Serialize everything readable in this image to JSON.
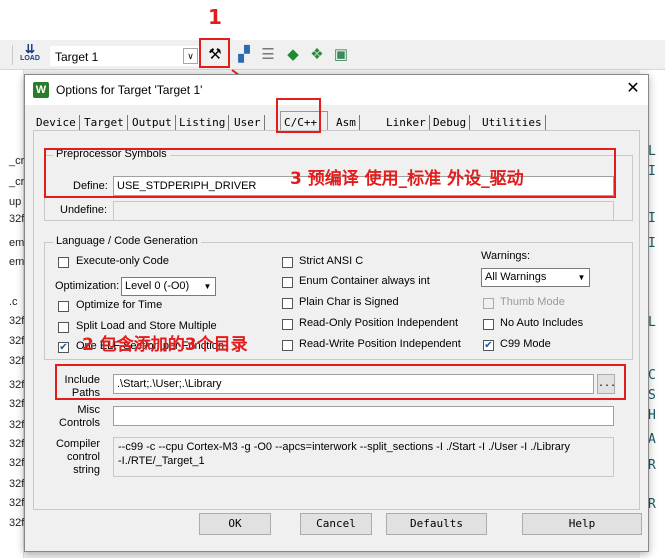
{
  "ide": {
    "target_name": "Target 1",
    "load_label": "LOAD",
    "left_fragments": [
      "_cr",
      "_cr",
      "up",
      "32f",
      "em",
      "em",
      ".c",
      "32f",
      "32f",
      "32f",
      "32f",
      "32f",
      "32f",
      "32f",
      "32f",
      "32f",
      "32f",
      "32f"
    ],
    "right_fragments": [
      "L",
      "I",
      "I",
      "I",
      "L",
      "C",
      "S",
      "H",
      "A",
      "R",
      "R"
    ]
  },
  "dialog": {
    "title": "Options for Target 'Target 1'",
    "close_glyph": "✕",
    "app_icon_letter": "W",
    "tabs": [
      "Device",
      "Target",
      "Output",
      "Listing",
      "User",
      "C/C++",
      "Asm",
      "Linker",
      "Debug",
      "Utilities"
    ],
    "active_tab": "C/C++",
    "preprocessor": {
      "group_title": "Preprocessor Symbols",
      "define_label": "Define:",
      "define_value": "USE_STDPERIPH_DRIVER",
      "undefine_label": "Undefine:",
      "undefine_value": ""
    },
    "language": {
      "group_title": "Language / Code Generation",
      "execute_only": "Execute-only Code",
      "optimization_label": "Optimization:",
      "optimization_value": "Level 0 (-O0)",
      "optimize_time": "Optimize for Time",
      "split_load": "Split Load and Store Multiple",
      "one_elf": "One ELF Section per Function",
      "strict_ansi": "Strict ANSI C",
      "enum_container": "Enum Container always int",
      "plain_char": "Plain Char is Signed",
      "ro_pi": "Read-Only Position Independent",
      "rw_pi": "Read-Write Position Independent",
      "warnings_label": "Warnings:",
      "warnings_value": "All Warnings",
      "thumb_mode": "Thumb Mode",
      "no_auto_includes": "No Auto Includes",
      "c99_mode": "C99 Mode"
    },
    "include_label_1": "Include",
    "include_label_2": "Paths",
    "include_value": ".\\Start;.\\User;.\\Library",
    "browse_label": "...",
    "misc_label_1": "Misc",
    "misc_label_2": "Controls",
    "misc_value": "",
    "compiler_label_1": "Compiler",
    "compiler_label_2": "control",
    "compiler_label_3": "string",
    "compiler_line_1": "--c99 -c --cpu Cortex-M3 -g -O0 --apcs=interwork --split_sections -I ./Start -I ./User -I ./Library",
    "compiler_line_2": "-I./RTE/_Target_1",
    "buttons": {
      "ok": "OK",
      "cancel": "Cancel",
      "defaults": "Defaults",
      "help": "Help"
    }
  },
  "annotations": {
    "step1": "1",
    "step2": "2 包含添加的3个目录",
    "step3": "3 预编译 使用_标准 外设_驱动"
  },
  "colors": {
    "annotation_red": "#e31c1c",
    "check_blue": "#1a5aa8"
  }
}
